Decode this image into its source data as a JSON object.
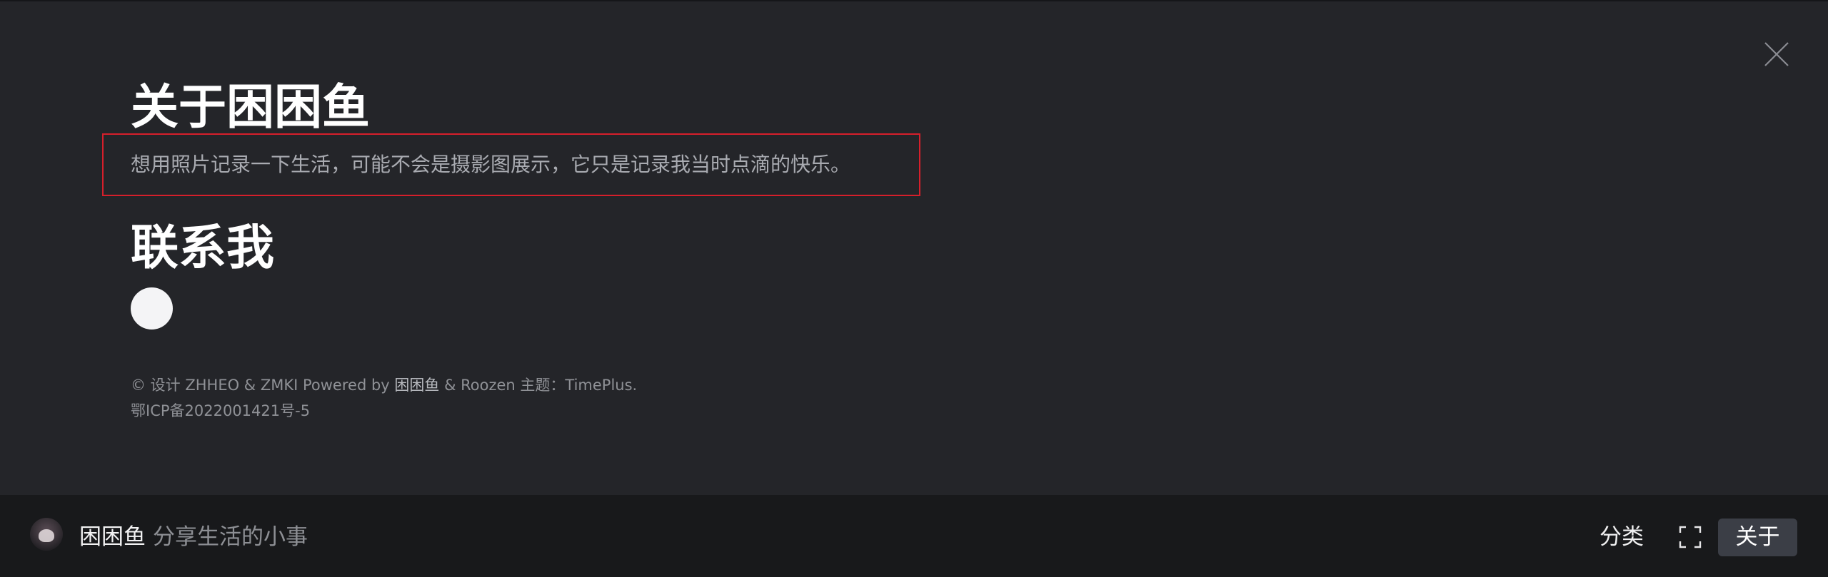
{
  "about": {
    "title": "关于困困鱼",
    "description": "想用照片记录一下生活，可能不会是摄影图展示，它只是记录我当时点滴的快乐。",
    "contact_title": "联系我",
    "contact_icon": "contact-circle-icon",
    "close_icon": "close-icon"
  },
  "footer": {
    "copyright_prefix": "© 设计 ZHHEO & ZMKI Powered by ",
    "author": "困困鱼",
    "copyright_mid": " & Roozen 主题：TimePlus.",
    "icp": "鄂ICP备2022001421号-5"
  },
  "bottom_bar": {
    "site_name": "困困鱼",
    "tagline": "分享生活的小事",
    "nav_category": "分类",
    "fullscreen_icon": "fullscreen-icon",
    "nav_about": "关于"
  },
  "colors": {
    "background": "#242529",
    "bottom_bar": "#18191b",
    "highlight_border": "#d61f2b",
    "active_nav": "#3b3e46"
  }
}
